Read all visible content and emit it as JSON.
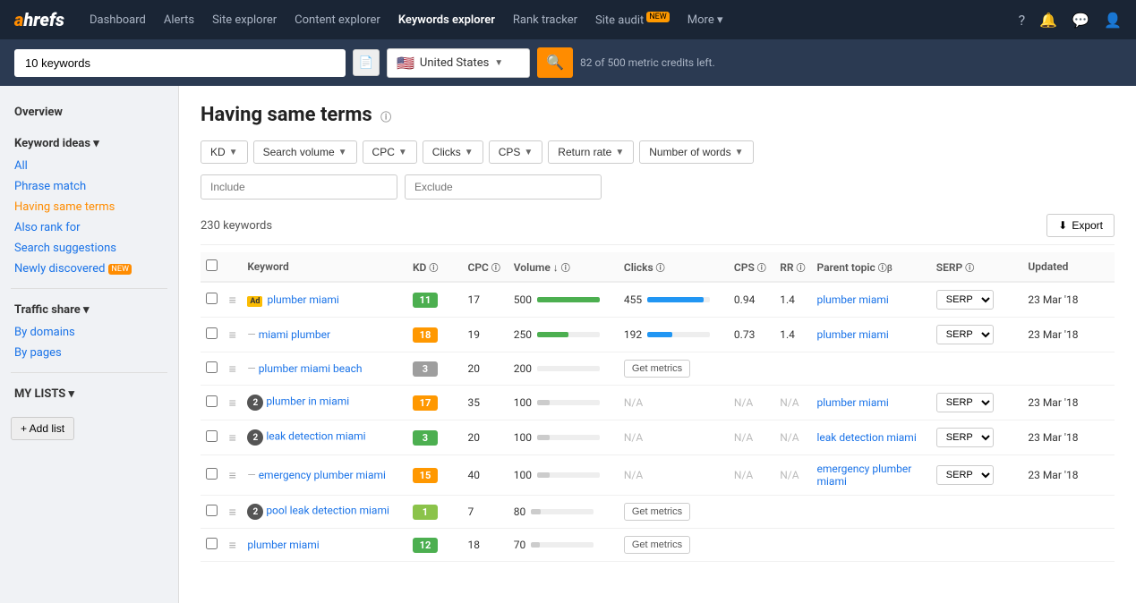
{
  "nav": {
    "logo": "ahrefs",
    "links": [
      {
        "label": "Dashboard",
        "active": false
      },
      {
        "label": "Alerts",
        "active": false
      },
      {
        "label": "Site explorer",
        "active": false
      },
      {
        "label": "Content explorer",
        "active": false
      },
      {
        "label": "Keywords explorer",
        "active": true
      },
      {
        "label": "Rank tracker",
        "active": false
      },
      {
        "label": "Site audit",
        "active": false,
        "badge": "NEW"
      },
      {
        "label": "More ▾",
        "active": false
      }
    ]
  },
  "searchbar": {
    "input_value": "10 keywords",
    "country": "United States",
    "credits_text": "82 of 500 metric credits left.",
    "search_btn_icon": "🔍"
  },
  "sidebar": {
    "overview_label": "Overview",
    "keyword_ideas_label": "Keyword ideas ▾",
    "items": [
      {
        "label": "All",
        "active": false
      },
      {
        "label": "Phrase match",
        "active": false
      },
      {
        "label": "Having same terms",
        "active": true
      },
      {
        "label": "Also rank for",
        "active": false
      },
      {
        "label": "Search suggestions",
        "active": false
      },
      {
        "label": "Newly discovered",
        "active": false,
        "badge": "NEW"
      }
    ],
    "traffic_share_label": "Traffic share ▾",
    "traffic_items": [
      {
        "label": "By domains"
      },
      {
        "label": "By pages"
      }
    ],
    "my_lists_label": "MY LISTS ▾"
  },
  "main": {
    "title": "Having same terms",
    "keywords_count": "230 keywords",
    "export_label": "Export",
    "filters": [
      {
        "label": "KD"
      },
      {
        "label": "Search volume"
      },
      {
        "label": "CPC"
      },
      {
        "label": "Clicks"
      },
      {
        "label": "CPS"
      },
      {
        "label": "Return rate"
      },
      {
        "label": "Number of words"
      }
    ],
    "include_placeholder": "Include",
    "exclude_placeholder": "Exclude",
    "table": {
      "headers": [
        "",
        "",
        "Keyword",
        "KD",
        "CPC",
        "Volume ↓",
        "Clicks",
        "CPS",
        "RR",
        "Parent topic",
        "SERP",
        "Updated"
      ],
      "rows": [
        {
          "keyword": "plumber miami",
          "ad": true,
          "kd": "11",
          "kd_color": "green",
          "cpc": "17",
          "volume": "500",
          "vol_pct": 100,
          "vol_color": "green",
          "clicks": "455",
          "clicks_pct": 90,
          "clicks_color": "blue",
          "cps": "0.94",
          "rr": "1.4",
          "parent_topic": "plumber miami",
          "serp": "SERP",
          "updated": "23 Mar '18",
          "circle": null,
          "get_metrics": false
        },
        {
          "keyword": "miami plumber",
          "ad": false,
          "kd": "18",
          "kd_color": "orange",
          "cpc": "19",
          "volume": "250",
          "vol_pct": 50,
          "vol_color": "green",
          "clicks": "192",
          "clicks_pct": 40,
          "clicks_color": "blue",
          "cps": "0.73",
          "rr": "1.4",
          "parent_topic": "plumber miami",
          "serp": "SERP",
          "updated": "23 Mar '18",
          "circle": null,
          "get_metrics": false,
          "dash": true
        },
        {
          "keyword": "plumber miami beach",
          "ad": false,
          "kd": "3",
          "kd_color": "grey",
          "cpc": "20",
          "volume": "200",
          "vol_pct": 0,
          "vol_color": "green",
          "clicks": "",
          "clicks_pct": 0,
          "clicks_color": "grey",
          "cps": "",
          "rr": "",
          "parent_topic": "",
          "serp": "",
          "updated": "",
          "circle": null,
          "get_metrics": true,
          "dash": true
        },
        {
          "keyword": "plumber in miami",
          "ad": false,
          "kd": "17",
          "kd_color": "orange",
          "cpc": "35",
          "volume": "100",
          "vol_pct": 20,
          "vol_color": "grey",
          "clicks": "N/A",
          "clicks_pct": 0,
          "clicks_color": "grey",
          "cps": "N/A",
          "rr": "N/A",
          "parent_topic": "plumber miami",
          "serp": "SERP",
          "updated": "23 Mar '18",
          "circle": "2",
          "get_metrics": false
        },
        {
          "keyword": "leak detection miami",
          "ad": false,
          "kd": "3",
          "kd_color": "green",
          "cpc": "20",
          "volume": "100",
          "vol_pct": 20,
          "vol_color": "grey",
          "clicks": "N/A",
          "clicks_pct": 0,
          "clicks_color": "grey",
          "cps": "N/A",
          "rr": "N/A",
          "parent_topic": "leak detection miami",
          "serp": "SERP",
          "updated": "23 Mar '18",
          "circle": "2",
          "get_metrics": false
        },
        {
          "keyword": "emergency plumber miami",
          "ad": false,
          "kd": "15",
          "kd_color": "orange",
          "cpc": "40",
          "volume": "100",
          "vol_pct": 20,
          "vol_color": "grey",
          "clicks": "N/A",
          "clicks_pct": 0,
          "clicks_color": "grey",
          "cps": "N/A",
          "rr": "N/A",
          "parent_topic": "emergency plumber miami",
          "serp": "SERP",
          "updated": "23 Mar '18",
          "circle": null,
          "get_metrics": false,
          "dash": true
        },
        {
          "keyword": "pool leak detection miami",
          "ad": false,
          "kd": "1",
          "kd_color": "light-green",
          "cpc": "7",
          "volume": "80",
          "vol_pct": 15,
          "vol_color": "grey",
          "clicks": "",
          "clicks_pct": 0,
          "clicks_color": "grey",
          "cps": "",
          "rr": "",
          "parent_topic": "",
          "serp": "",
          "updated": "",
          "circle": "2",
          "get_metrics": true
        },
        {
          "keyword": "plumber miami",
          "ad": false,
          "kd": "12",
          "kd_color": "green",
          "cpc": "18",
          "volume": "70",
          "vol_pct": 14,
          "vol_color": "grey",
          "clicks": "",
          "clicks_pct": 0,
          "clicks_color": "grey",
          "cps": "",
          "rr": "",
          "parent_topic": "",
          "serp": "",
          "updated": "",
          "circle": null,
          "get_metrics": true
        }
      ]
    }
  }
}
